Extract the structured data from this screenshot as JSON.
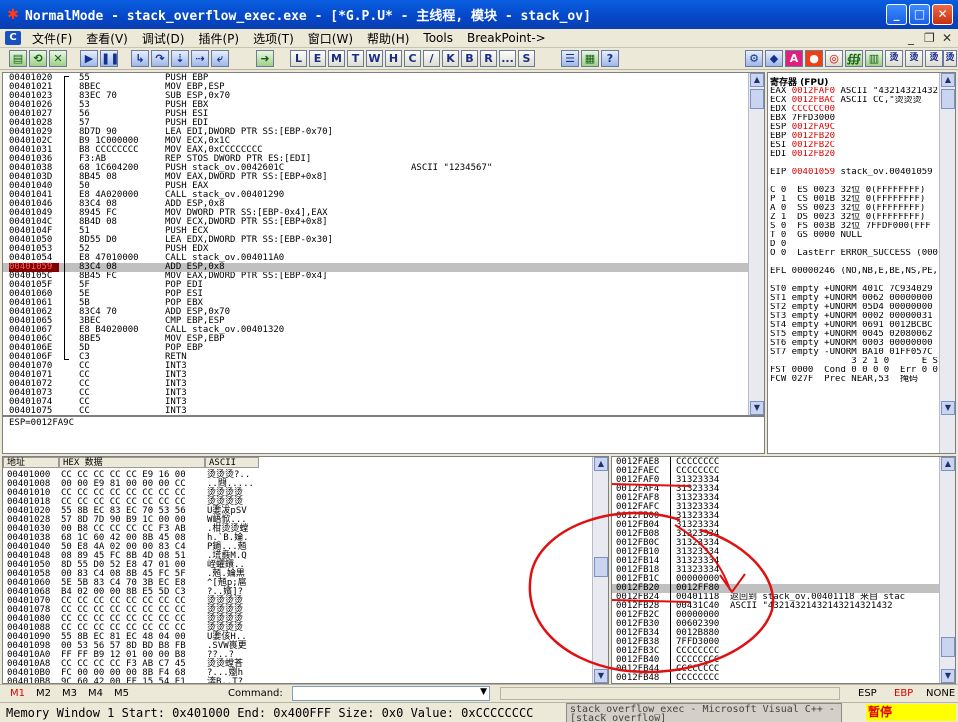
{
  "title": "NormalMode - stack_overflow_exec.exe - [*G.P.U* -  主线程, 模块 - stack_ov]",
  "menu": [
    "文件(F)",
    "查看(V)",
    "调试(D)",
    "插件(P)",
    "选项(T)",
    "窗口(W)",
    "帮助(H)",
    "Tools",
    "BreakPoint->"
  ],
  "toolbar_letters": [
    "L",
    "E",
    "M",
    "T",
    "W",
    "H",
    "C",
    "/",
    "K",
    "B",
    "R",
    "...",
    "S"
  ],
  "disasm": [
    {
      "a": "00401020",
      "h": "55",
      "i": "PUSH EBP"
    },
    {
      "a": "00401021",
      "h": "8BEC",
      "i": "MOV EBP,ESP"
    },
    {
      "a": "00401023",
      "h": "83EC 70",
      "i": "SUB ESP,0x70"
    },
    {
      "a": "00401026",
      "h": "53",
      "i": "PUSH EBX"
    },
    {
      "a": "00401027",
      "h": "56",
      "i": "PUSH ESI"
    },
    {
      "a": "00401028",
      "h": "57",
      "i": "PUSH EDI"
    },
    {
      "a": "00401029",
      "h": "8D7D 90",
      "i": "LEA EDI,DWORD PTR SS:[EBP-0x70]"
    },
    {
      "a": "0040102C",
      "h": "B9 1C000000",
      "i": "MOV ECX,0x1C"
    },
    {
      "a": "00401031",
      "h": "B8 CCCCCCCC",
      "i": "MOV EAX,0xCCCCCCCC"
    },
    {
      "a": "00401036",
      "h": "F3:AB",
      "i": "REP STOS DWORD PTR ES:[EDI]"
    },
    {
      "a": "00401038",
      "h": "68 1C604200",
      "i": "PUSH stack_ov.0042601C",
      "c": "ASCII \"1234567\""
    },
    {
      "a": "0040103D",
      "h": "8B45 08",
      "i": "MOV EAX,DWORD PTR SS:[EBP+0x8]"
    },
    {
      "a": "00401040",
      "h": "50",
      "i": "PUSH EAX"
    },
    {
      "a": "00401041",
      "h": "E8 4A020000",
      "i": "CALL stack_ov.00401290"
    },
    {
      "a": "00401046",
      "h": "83C4 08",
      "i": "ADD ESP,0x8"
    },
    {
      "a": "00401049",
      "h": "8945 FC",
      "i": "MOV DWORD PTR SS:[EBP-0x4],EAX"
    },
    {
      "a": "0040104C",
      "h": "8B4D 08",
      "i": "MOV ECX,DWORD PTR SS:[EBP+0x8]"
    },
    {
      "a": "0040104F",
      "h": "51",
      "i": "PUSH ECX"
    },
    {
      "a": "00401050",
      "h": "8D55 D0",
      "i": "LEA EDX,DWORD PTR SS:[EBP-0x30]"
    },
    {
      "a": "00401053",
      "h": "52",
      "i": "PUSH EDX"
    },
    {
      "a": "00401054",
      "h": "E8 47010000",
      "i": "CALL stack_ov.004011A0"
    },
    {
      "a": "00401059",
      "h": "83C4 08",
      "i": "ADD ESP,0x8",
      "cur": true
    },
    {
      "a": "0040105C",
      "h": "8B45 FC",
      "i": "MOV EAX,DWORD PTR SS:[EBP-0x4]"
    },
    {
      "a": "0040105F",
      "h": "5F",
      "i": "POP EDI"
    },
    {
      "a": "00401060",
      "h": "5E",
      "i": "POP ESI"
    },
    {
      "a": "00401061",
      "h": "5B",
      "i": "POP EBX"
    },
    {
      "a": "00401062",
      "h": "83C4 70",
      "i": "ADD ESP,0x70"
    },
    {
      "a": "00401065",
      "h": "3BEC",
      "i": "CMP EBP,ESP"
    },
    {
      "a": "00401067",
      "h": "E8 B4020000",
      "i": "CALL stack_ov.00401320"
    },
    {
      "a": "0040106C",
      "h": "8BE5",
      "i": "MOV ESP,EBP"
    },
    {
      "a": "0040106E",
      "h": "5D",
      "i": "POP EBP"
    },
    {
      "a": "0040106F",
      "h": "C3",
      "i": "RETN"
    },
    {
      "a": "00401070",
      "h": "CC",
      "i": "INT3"
    },
    {
      "a": "00401071",
      "h": "CC",
      "i": "INT3"
    },
    {
      "a": "00401072",
      "h": "CC",
      "i": "INT3"
    },
    {
      "a": "00401073",
      "h": "CC",
      "i": "INT3"
    },
    {
      "a": "00401074",
      "h": "CC",
      "i": "INT3"
    },
    {
      "a": "00401075",
      "h": "CC",
      "i": "INT3"
    }
  ],
  "info_line": "ESP=0012FA9C",
  "registers": {
    "title": "寄存器 (FPU)",
    "lines": [
      {
        "t": "EAX 0012FAF0 ASCII \"43214321432",
        "r": "0012FAF0"
      },
      {
        "t": "ECX 0012FBAC ASCII CC,\"烫烫烫",
        "r": "0012FBAC"
      },
      {
        "t": "EDX CCCCCC00",
        "r": "CCCCCC00"
      },
      {
        "t": "EBX 7FFD3000"
      },
      {
        "t": "ESP 0012FA9C",
        "r": "0012FA9C"
      },
      {
        "t": "EBP 0012FB20",
        "r": "0012FB20"
      },
      {
        "t": "ESI 0012FB2C",
        "r": "0012FB2C"
      },
      {
        "t": "EDI 0012FB20",
        "r": "0012FB20"
      },
      {
        "t": ""
      },
      {
        "t": "EIP 00401059 stack_ov.00401059",
        "r": "00401059"
      },
      {
        "t": ""
      },
      {
        "t": "C 0  ES 0023 32位 0(FFFFFFFF)"
      },
      {
        "t": "P 1  CS 001B 32位 0(FFFFFFFF)"
      },
      {
        "t": "A 0  SS 0023 32位 0(FFFFFFFF)"
      },
      {
        "t": "Z 1  DS 0023 32位 0(FFFFFFFF)"
      },
      {
        "t": "S 0  FS 003B 32位 7FFDF000(FFF"
      },
      {
        "t": "T 0  GS 0000 NULL"
      },
      {
        "t": "D 0"
      },
      {
        "t": "O 0  LastErr ERROR_SUCCESS (000"
      },
      {
        "t": ""
      },
      {
        "t": "EFL 00000246 (NO,NB,E,BE,NS,PE,"
      },
      {
        "t": ""
      },
      {
        "t": "ST0 empty +UNORM 401C 7C934029"
      },
      {
        "t": "ST1 empty +UNORM 0062 00000000"
      },
      {
        "t": "ST2 empty +UNORM 05D4 00000000"
      },
      {
        "t": "ST3 empty +UNORM 0002 00000031"
      },
      {
        "t": "ST4 empty +UNORM 0691 0012BCBC"
      },
      {
        "t": "ST5 empty +UNORM 0045 02080062"
      },
      {
        "t": "ST6 empty +UNORM 0003 00000000"
      },
      {
        "t": "ST7 empty -UNORM BA10 01FF057C"
      },
      {
        "t": "               3 2 1 0      E S"
      },
      {
        "t": "FST 0000  Cond 0 0 0 0  Err 0 0"
      },
      {
        "t": "FCW 027F  Prec NEAR,53  掩码"
      }
    ]
  },
  "dump": {
    "headers": [
      "地址",
      "HEX 数据",
      "ASCII"
    ],
    "rows": [
      {
        "a": "00401000",
        "h": "CC CC CC CC CC E9 16 00",
        "s": "烫烫烫?.."
      },
      {
        "a": "00401008",
        "h": "00 00 E9 81 00 00 00 CC",
        "s": "..閰....."
      },
      {
        "a": "00401010",
        "h": "CC CC CC CC CC CC CC CC",
        "s": "烫烫烫烫"
      },
      {
        "a": "00401018",
        "h": "CC CC CC CC CC CC CC CC",
        "s": "烫烫烫烫"
      },
      {
        "a": "00401020",
        "h": "55 8B EC 83 EC 70 53 56",
        "s": "U嬱冹pSV"
      },
      {
        "a": "00401028",
        "h": "57 8D 7D 90 B9 1C 00 00",
        "s": "W峿惞..."
      },
      {
        "a": "00401030",
        "h": "00 B8 CC CC CC CC F3 AB",
        "s": ".柑烫烫螳"
      },
      {
        "a": "00401038",
        "h": "68 1C 60 42 00 8B 45 08",
        "s": "h.`B.婨."
      },
      {
        "a": "00401040",
        "h": "50 E8 4A 02 00 00 83 C4",
        "s": "P鐹...兡"
      },
      {
        "a": "00401048",
        "h": "08 89 45 FC 8B 4D 08 51",
        "s": ".塃鼖M.Q"
      },
      {
        "a": "00401050",
        "h": "8D 55 D0 52 E8 47 01 00",
        "s": "峌蠷鐶.."
      },
      {
        "a": "00401058",
        "h": "00 83 C4 08 8B 45 FC 5F",
        "s": ".兡.婨黒"
      },
      {
        "a": "00401060",
        "h": "5E 5B 83 C4 70 3B EC E8",
        "s": "^[兡p;扈"
      },
      {
        "a": "00401068",
        "h": "B4 02 00 00 8B E5 5D C3",
        "s": "?..嬪]?"
      },
      {
        "a": "00401070",
        "h": "CC CC CC CC CC CC CC CC",
        "s": "烫烫烫烫"
      },
      {
        "a": "00401078",
        "h": "CC CC CC CC CC CC CC CC",
        "s": "烫烫烫烫"
      },
      {
        "a": "00401080",
        "h": "CC CC CC CC CC CC CC CC",
        "s": "烫烫烫烫"
      },
      {
        "a": "00401088",
        "h": "CC CC CC CC CC CC CC CC",
        "s": "烫烫烫烫"
      },
      {
        "a": "00401090",
        "h": "55 8B EC 81 EC 48 04 00",
        "s": "U嬱侅H.."
      },
      {
        "a": "00401098",
        "h": "00 53 56 57 8D BD B8 FB",
        "s": ".SVW嵔更"
      },
      {
        "a": "004010A0",
        "h": "FF FF B9 12 01 00 00 B8",
        "s": "??..?"
      },
      {
        "a": "004010A8",
        "h": "CC CC CC CC F3 AB C7 45",
        "s": "烫烫螳荅"
      },
      {
        "a": "004010B0",
        "h": "FC 00 00 00 00 8B F4 68",
        "s": "?...嬼h"
      },
      {
        "a": "004010B8",
        "h": "9C 60 42 00 FF 15 54 E1",
        "s": "渀B..T?"
      }
    ]
  },
  "stack": [
    {
      "a": "0012FAE8",
      "v": "CCCCCCCC"
    },
    {
      "a": "0012FAEC",
      "v": "CCCCCCCC"
    },
    {
      "a": "0012FAF0",
      "v": "31323334"
    },
    {
      "a": "0012FAF4",
      "v": "31323334"
    },
    {
      "a": "0012FAF8",
      "v": "31323334"
    },
    {
      "a": "0012FAFC",
      "v": "31323334"
    },
    {
      "a": "0012FB00",
      "v": "31323334"
    },
    {
      "a": "0012FB04",
      "v": "31323334"
    },
    {
      "a": "0012FB08",
      "v": "31323334"
    },
    {
      "a": "0012FB0C",
      "v": "31323334"
    },
    {
      "a": "0012FB10",
      "v": "31323334"
    },
    {
      "a": "0012FB14",
      "v": "31323334"
    },
    {
      "a": "0012FB18",
      "v": "31323334"
    },
    {
      "a": "0012FB1C",
      "v": "00000000"
    },
    {
      "a": "0012FB20",
      "v": "0012FF80",
      "hl": true
    },
    {
      "a": "0012FB24",
      "v": "00401118",
      "c": "返回到 stack_ov.00401118 来自 stac"
    },
    {
      "a": "0012FB28",
      "v": "00431C40",
      "c": "ASCII \"43214321432143214321432"
    },
    {
      "a": "0012FB2C",
      "v": "00000000"
    },
    {
      "a": "0012FB30",
      "v": "00602390"
    },
    {
      "a": "0012FB34",
      "v": "0012B880"
    },
    {
      "a": "0012FB38",
      "v": "7FFD3000"
    },
    {
      "a": "0012FB3C",
      "v": "CCCCCCCC"
    },
    {
      "a": "0012FB40",
      "v": "CCCCCCCC"
    },
    {
      "a": "0012FB44",
      "v": "CCCCCCCC"
    },
    {
      "a": "0012FB48",
      "v": "CCCCCCCC"
    }
  ],
  "status_tabs": [
    "M1",
    "M2",
    "M3",
    "M4",
    "M5"
  ],
  "command_label": "Command:",
  "status_regs": [
    "ESP",
    "EBP",
    "NONE"
  ],
  "bottom_status": "Memory Window 1  Start: 0x401000  End: 0x400FFF  Size: 0x0 Value: 0xCCCCCCCC",
  "taskbar_item": "stack_overflow_exec - Microsoft Visual C++ - [stack_overflow]",
  "paused": "暂停",
  "colors": {
    "accent_red": "#e00000",
    "title_blue": "#0546c8",
    "annotation": "#e01010"
  }
}
